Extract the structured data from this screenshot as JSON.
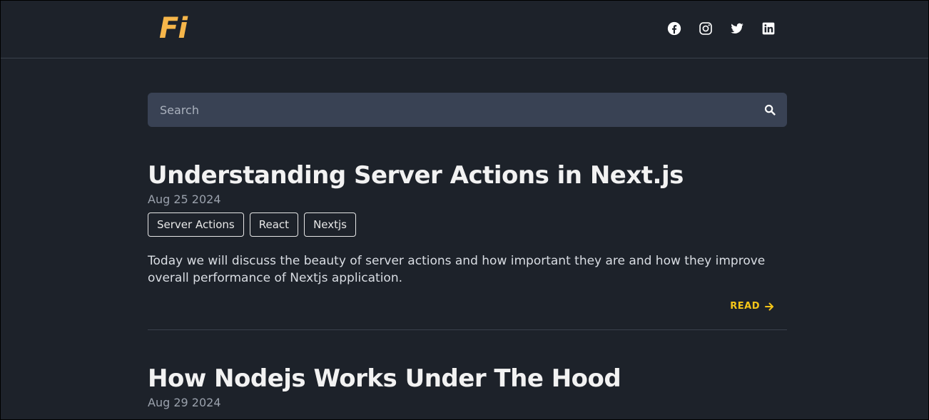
{
  "header": {
    "logo_text": "Fi",
    "socials": [
      {
        "icon": "facebook-icon"
      },
      {
        "icon": "instagram-icon"
      },
      {
        "icon": "twitter-icon"
      },
      {
        "icon": "linkedin-icon"
      }
    ]
  },
  "search": {
    "placeholder": "Search",
    "value": ""
  },
  "posts": [
    {
      "title": "Understanding Server Actions in Next.js",
      "date": "Aug 25 2024",
      "tags": [
        "Server Actions",
        "React",
        "Nextjs"
      ],
      "summary": "Today we will discuss the beauty of server actions and how important they are and how they improve overall performance of Nextjs application.",
      "read_label": "READ"
    },
    {
      "title": "How Nodejs Works Under The Hood",
      "date": "Aug 29 2024"
    }
  ],
  "colors": {
    "background": "#1d222a",
    "search_background": "#394254",
    "logo": "#f6b64a",
    "accent": "#f5c518"
  }
}
